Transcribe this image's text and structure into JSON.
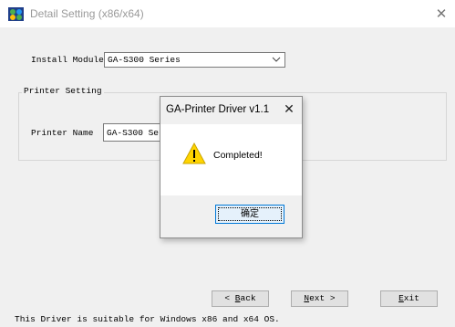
{
  "window": {
    "title": "Detail Setting (x86/x64)",
    "close_glyph": "✕"
  },
  "install": {
    "label": "Install Module",
    "selected": "GA-S300 Series"
  },
  "printer_setting": {
    "group_title": "Printer Setting",
    "name_label": "Printer Name",
    "name_value": "GA-S300 Series"
  },
  "nav": {
    "back_prefix": "< ",
    "back_key": "B",
    "back_rest": "ack",
    "next_key": "N",
    "next_rest": "ext >",
    "exit_key": "E",
    "exit_rest": "xit"
  },
  "footer": "This Driver is suitable for Windows x86 and x64 OS.",
  "dialog": {
    "title": "GA-Printer Driver v1.1",
    "close_glyph": "✕",
    "message": "Completed!",
    "ok_label": "确定",
    "icon": "warning-icon"
  },
  "colors": {
    "warning": "#ffd400",
    "accent": "#0078d7"
  }
}
